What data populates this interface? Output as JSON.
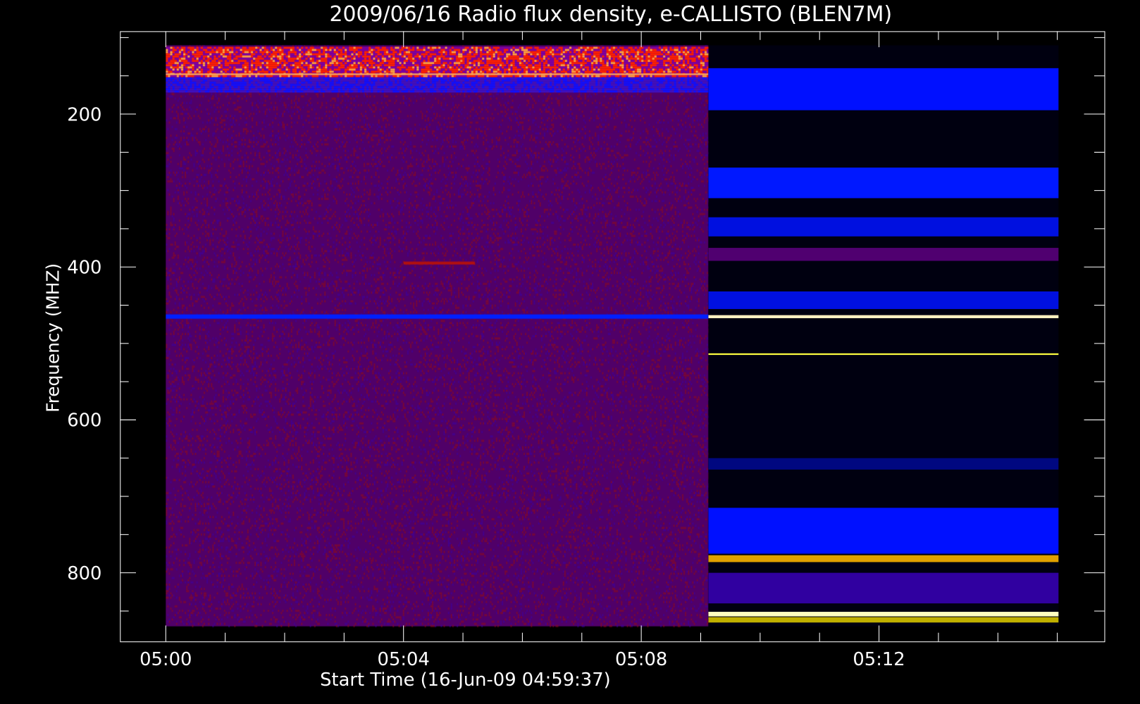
{
  "chart_data": {
    "type": "heatmap",
    "title": "2009/06/16  Radio flux density, e-CALLISTO (BLEN7M)",
    "xlabel": "Start Time (16-Jun-09 04:59:37)",
    "ylabel": "Frequency (MHZ)",
    "x_ticks": [
      "05:00",
      "05:04",
      "05:08",
      "05:12"
    ],
    "x_tick_minutes": [
      0,
      4,
      8,
      12
    ],
    "y_ticks": [
      "200",
      "400",
      "600",
      "800"
    ],
    "y_tick_values": [
      200,
      400,
      600,
      800
    ],
    "xlim_minutes": [
      -0.77,
      15.8
    ],
    "ylim_mhz": [
      890,
      92
    ],
    "data_extent": {
      "observed_end_minute": 9.13,
      "background_end_minute": 15.02,
      "freq_min": 110,
      "freq_max": 870
    },
    "features": [
      {
        "label": "RFI band",
        "freq_range": [
          115,
          165
        ],
        "color": "#ff3000"
      },
      {
        "label": "interference line",
        "freq": 465,
        "color": "#0020ff"
      },
      {
        "label": "burst",
        "freq": 395,
        "minute_range": [
          4.0,
          5.2
        ],
        "color": "#b01010"
      }
    ],
    "background_bands": [
      {
        "freq_range": [
          140,
          195
        ],
        "color": "#0010ff"
      },
      {
        "freq_range": [
          270,
          310
        ],
        "color": "#0018ff"
      },
      {
        "freq_range": [
          335,
          360
        ],
        "color": "#0010e0"
      },
      {
        "freq_range": [
          375,
          392
        ],
        "color": "#500070"
      },
      {
        "freq_range": [
          432,
          455
        ],
        "color": "#0010e0"
      },
      {
        "freq_range": [
          463,
          467
        ],
        "color": "#fff0c0"
      },
      {
        "freq_range": [
          513,
          515
        ],
        "color": "#ffff40"
      },
      {
        "freq_range": [
          650,
          665
        ],
        "color": "#000880"
      },
      {
        "freq_range": [
          715,
          775
        ],
        "color": "#0010ff"
      },
      {
        "freq_range": [
          777,
          786
        ],
        "color": "#e0a000"
      },
      {
        "freq_range": [
          800,
          840
        ],
        "color": "#3000a0"
      },
      {
        "freq_range": [
          851,
          857
        ],
        "color": "#ffffc0"
      },
      {
        "freq_range": [
          858,
          865
        ],
        "color": "#c0b000"
      }
    ]
  }
}
